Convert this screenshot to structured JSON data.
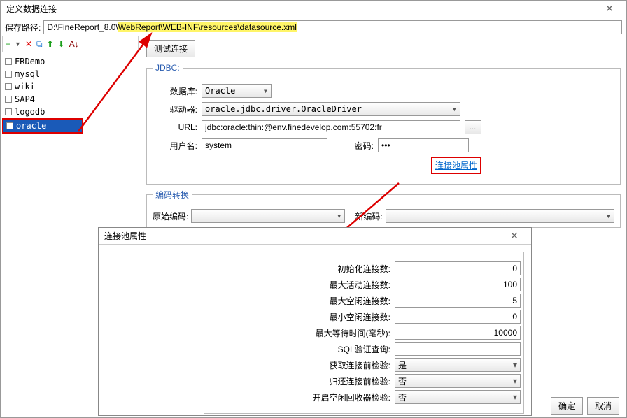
{
  "main": {
    "title": "定义数据连接",
    "path_label": "保存路径:",
    "path_prefix": "D:\\FineReport_8.0\\",
    "path_hl": "WebReport\\WEB-INF\\resources\\datasource.xml"
  },
  "toolbar": {
    "add": "+",
    "del": "✕",
    "copy": "⧉",
    "up": "⬆",
    "down": "⬇",
    "sort": "A↓"
  },
  "dbs": [
    {
      "name": "FRDemo"
    },
    {
      "name": "mysql"
    },
    {
      "name": "wiki"
    },
    {
      "name": "SAP4"
    },
    {
      "name": "logodb"
    },
    {
      "name": "oracle",
      "selected": true
    }
  ],
  "form": {
    "test_btn": "测试连接",
    "jdbc_legend": "JDBC:",
    "db_label": "数据库:",
    "db_value": "Oracle",
    "driver_label": "驱动器:",
    "driver_value": "oracle.jdbc.driver.OracleDriver",
    "url_label": "URL:",
    "url_value": "jdbc:oracle:thin:@env.finedevelop.com:55702:fr",
    "user_label": "用户名:",
    "user_value": "system",
    "pass_label": "密码:",
    "pass_value": "•••",
    "pool_link": "连接池属性",
    "enc_legend": "编码转换",
    "enc_orig_label": "原始编码:",
    "enc_new_label": "新编码:"
  },
  "footer": {
    "ok": "确定",
    "cancel": "取消"
  },
  "popup": {
    "title": "连接池属性",
    "rows": [
      {
        "label": "初始化连接数:",
        "value": "0",
        "type": "num"
      },
      {
        "label": "最大活动连接数:",
        "value": "100",
        "type": "num"
      },
      {
        "label": "最大空闲连接数:",
        "value": "5",
        "type": "num"
      },
      {
        "label": "最小空闲连接数:",
        "value": "0",
        "type": "num"
      },
      {
        "label": "最大等待时间(毫秒):",
        "value": "10000",
        "type": "num"
      },
      {
        "label": "SQL验证查询:",
        "value": "",
        "type": "text"
      },
      {
        "label": "获取连接前检验:",
        "value": "是",
        "type": "sel"
      },
      {
        "label": "归还连接前检验:",
        "value": "否",
        "type": "sel"
      },
      {
        "label": "开启空闲回收器检验:",
        "value": "否",
        "type": "sel"
      }
    ]
  }
}
